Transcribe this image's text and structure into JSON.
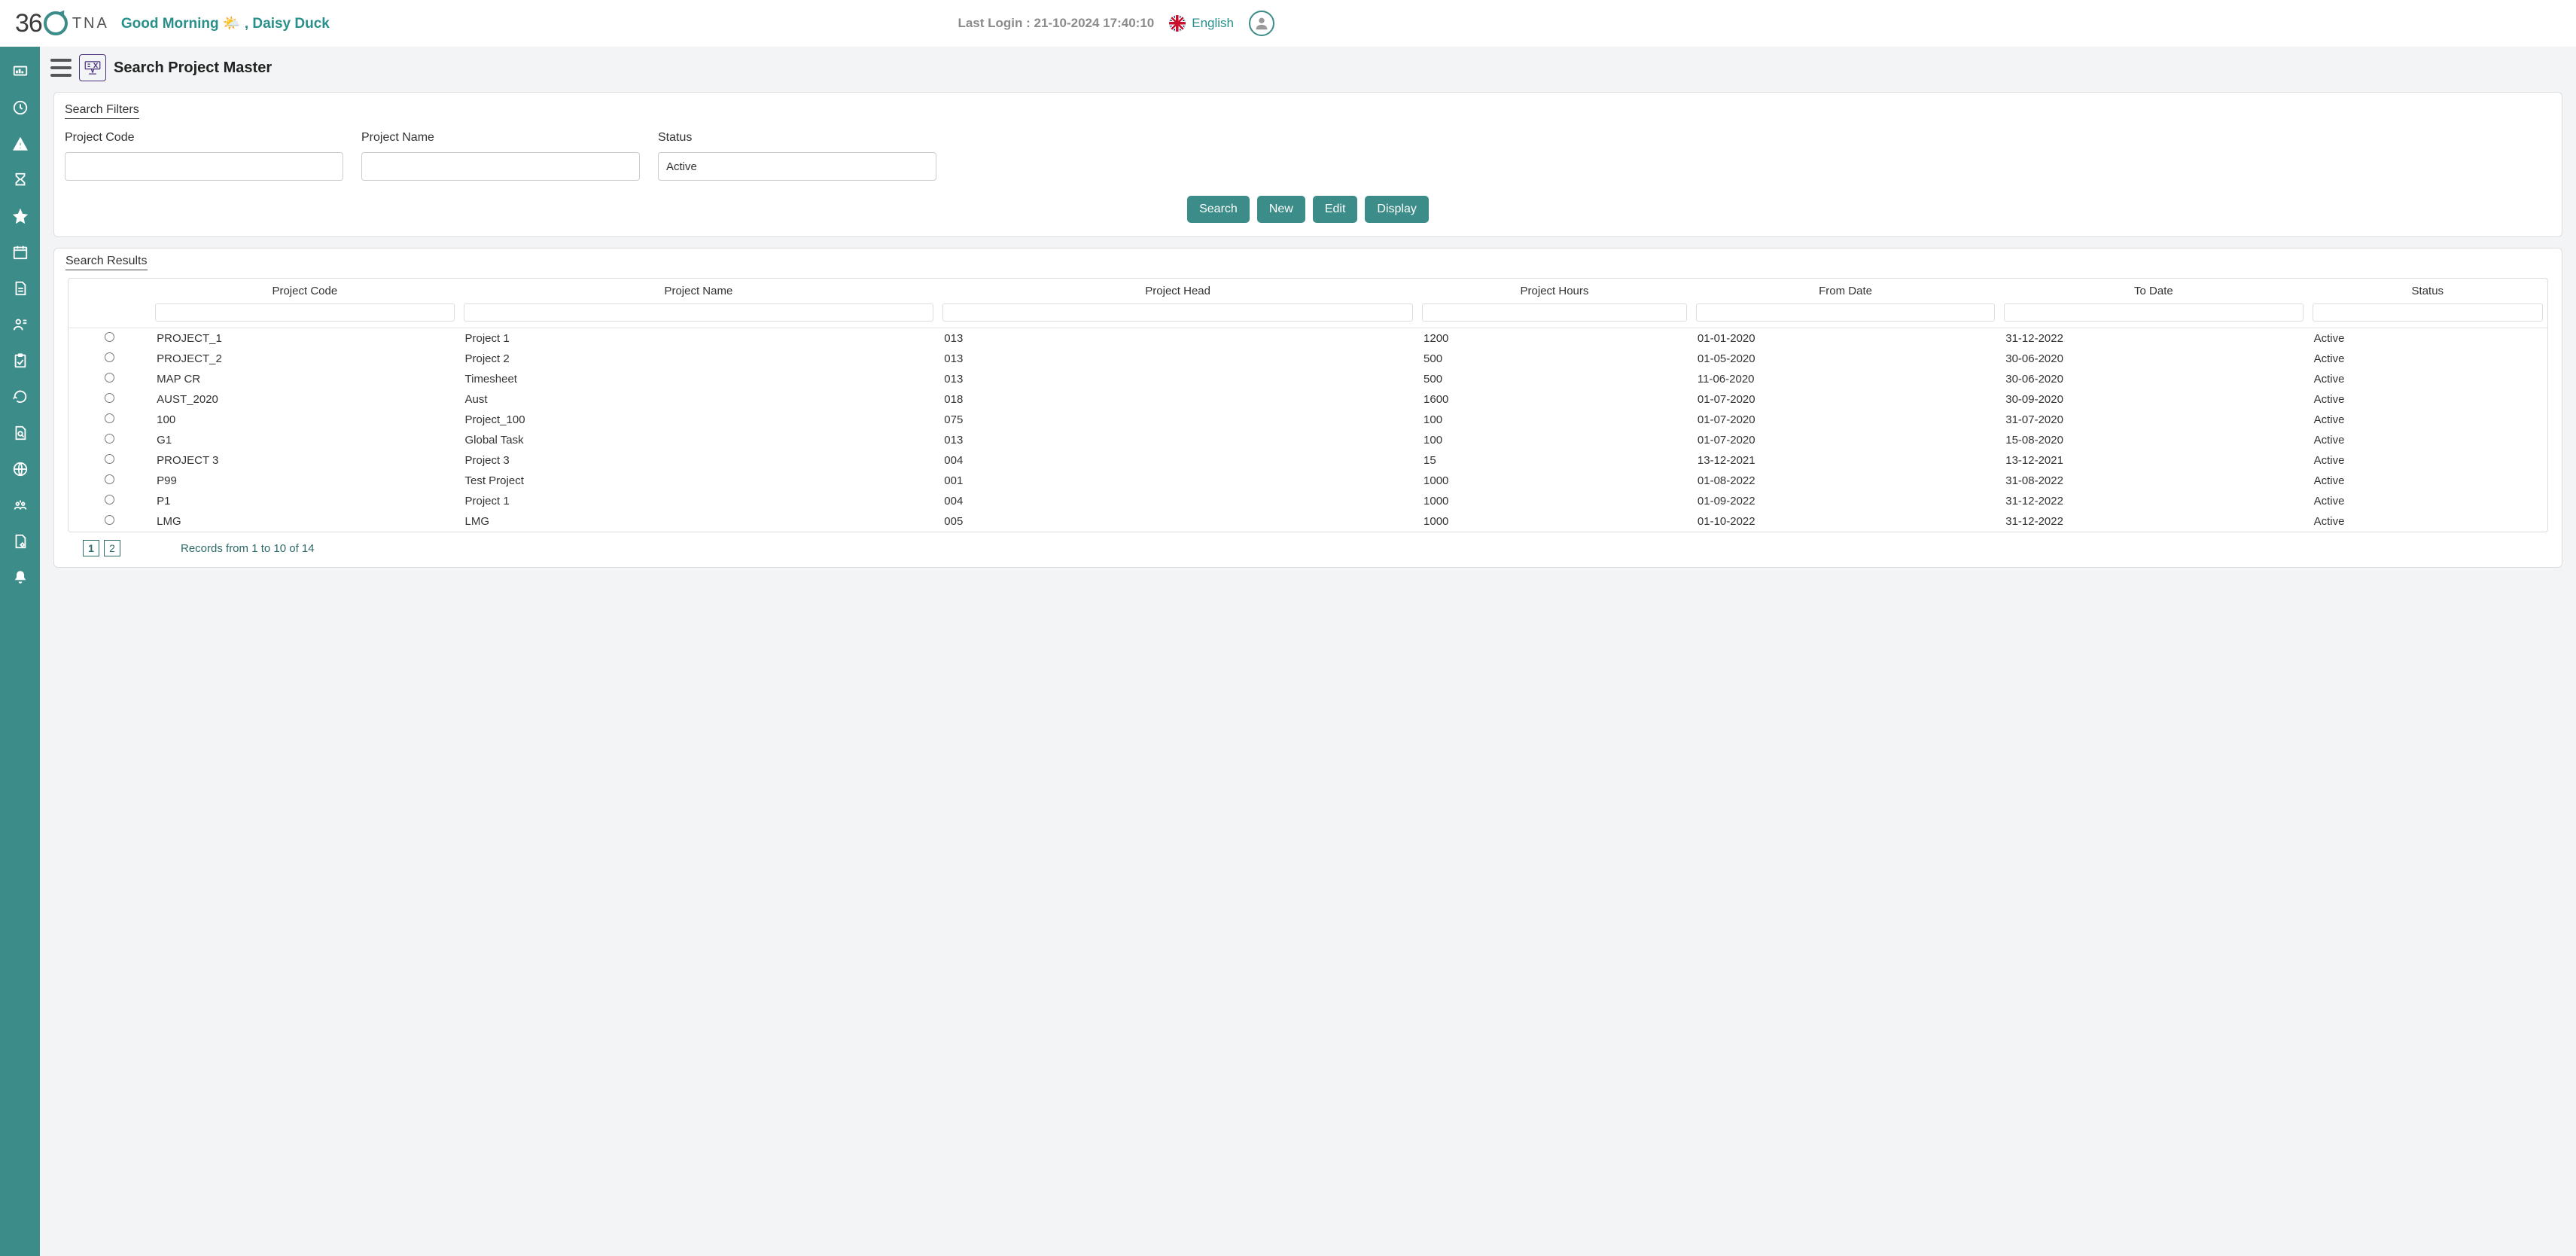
{
  "header": {
    "logo_text_prefix": "36",
    "logo_text_suffix": "TNA",
    "greeting": "Good Morning 🌤️ , Daisy Duck",
    "last_login_label": "Last Login : 21-10-2024 17:40:10",
    "language": "English"
  },
  "page": {
    "title": "Search Project Master"
  },
  "filters": {
    "legend": "Search Filters",
    "project_code": {
      "label": "Project Code",
      "value": ""
    },
    "project_name": {
      "label": "Project Name",
      "value": ""
    },
    "status": {
      "label": "Status",
      "value": "Active"
    }
  },
  "buttons": {
    "search": "Search",
    "new": "New",
    "edit": "Edit",
    "display": "Display"
  },
  "results": {
    "legend": "Search Results",
    "columns": {
      "code": "Project Code",
      "name": "Project Name",
      "head": "Project Head",
      "hours": "Project Hours",
      "from": "From Date",
      "to": "To Date",
      "status": "Status"
    },
    "rows": [
      {
        "code": "PROJECT_1",
        "name": "Project 1",
        "head": "013",
        "hours": "1200",
        "from": "01-01-2020",
        "to": "31-12-2022",
        "status": "Active"
      },
      {
        "code": "PROJECT_2",
        "name": "Project 2",
        "head": "013",
        "hours": "500",
        "from": "01-05-2020",
        "to": "30-06-2020",
        "status": "Active"
      },
      {
        "code": "MAP CR",
        "name": "Timesheet",
        "head": "013",
        "hours": "500",
        "from": "11-06-2020",
        "to": "30-06-2020",
        "status": "Active"
      },
      {
        "code": "AUST_2020",
        "name": "Aust",
        "head": "018",
        "hours": "1600",
        "from": "01-07-2020",
        "to": "30-09-2020",
        "status": "Active"
      },
      {
        "code": "100",
        "name": "Project_100",
        "head": "075",
        "hours": "100",
        "from": "01-07-2020",
        "to": "31-07-2020",
        "status": "Active"
      },
      {
        "code": "G1",
        "name": "Global Task",
        "head": "013",
        "hours": "100",
        "from": "01-07-2020",
        "to": "15-08-2020",
        "status": "Active"
      },
      {
        "code": "PROJECT 3",
        "name": "Project 3",
        "head": "004",
        "hours": "15",
        "from": "13-12-2021",
        "to": "13-12-2021",
        "status": "Active"
      },
      {
        "code": "P99",
        "name": "Test Project",
        "head": "001",
        "hours": "1000",
        "from": "01-08-2022",
        "to": "31-08-2022",
        "status": "Active"
      },
      {
        "code": "P1",
        "name": "Project 1",
        "head": "004",
        "hours": "1000",
        "from": "01-09-2022",
        "to": "31-12-2022",
        "status": "Active"
      },
      {
        "code": "LMG",
        "name": "LMG",
        "head": "005",
        "hours": "1000",
        "from": "01-10-2022",
        "to": "31-12-2022",
        "status": "Active"
      }
    ],
    "pager": {
      "pages": [
        "1",
        "2"
      ],
      "active": "1",
      "summary": "Records from 1 to 10 of 14"
    }
  },
  "sidenav_icons": [
    "dashboard-icon",
    "clock-icon",
    "warning-icon",
    "hourglass-icon",
    "star-icon",
    "calendar-icon",
    "document-icon",
    "team-icon",
    "clipboard-check-icon",
    "refresh-icon",
    "file-search-icon",
    "globe-icon",
    "crowd-icon",
    "file-gear-icon",
    "bell-icon"
  ]
}
